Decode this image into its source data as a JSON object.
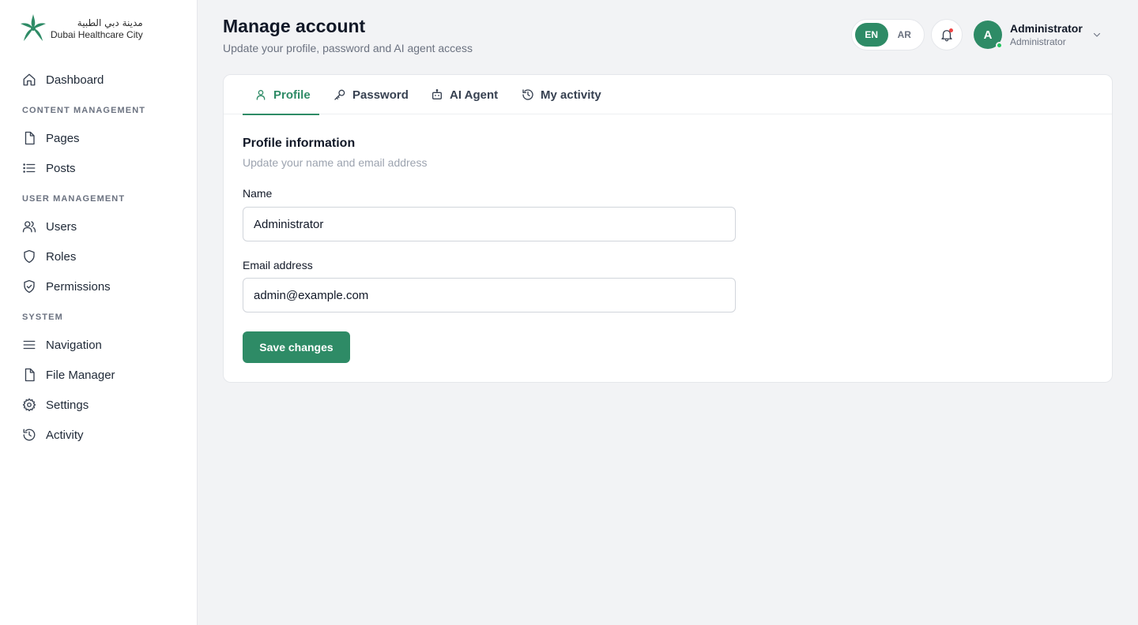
{
  "brand": {
    "name_ar": "مدينة دبي الطبية",
    "name_en": "Dubai Healthcare City",
    "color": "#2e8b66"
  },
  "sidebar": {
    "dashboard": "Dashboard",
    "sections": {
      "content": "CONTENT MANAGEMENT",
      "users": "USER MANAGEMENT",
      "system": "SYSTEM"
    },
    "items": {
      "pages": "Pages",
      "posts": "Posts",
      "users": "Users",
      "roles": "Roles",
      "permissions": "Permissions",
      "navigation": "Navigation",
      "file_manager": "File Manager",
      "settings": "Settings",
      "activity": "Activity"
    }
  },
  "header": {
    "title": "Manage account",
    "subtitle": "Update your profile, password and AI agent access",
    "lang": {
      "en": "EN",
      "ar": "AR",
      "active": "EN"
    },
    "user": {
      "initial": "A",
      "name": "Administrator",
      "role": "Administrator"
    }
  },
  "tabs": {
    "profile": "Profile",
    "password": "Password",
    "ai_agent": "AI Agent",
    "my_activity": "My activity",
    "active": "Profile"
  },
  "profile_form": {
    "title": "Profile information",
    "description": "Update your name and email address",
    "name_label": "Name",
    "name_value": "Administrator",
    "email_label": "Email address",
    "email_value": "admin@example.com",
    "save_label": "Save changes"
  }
}
